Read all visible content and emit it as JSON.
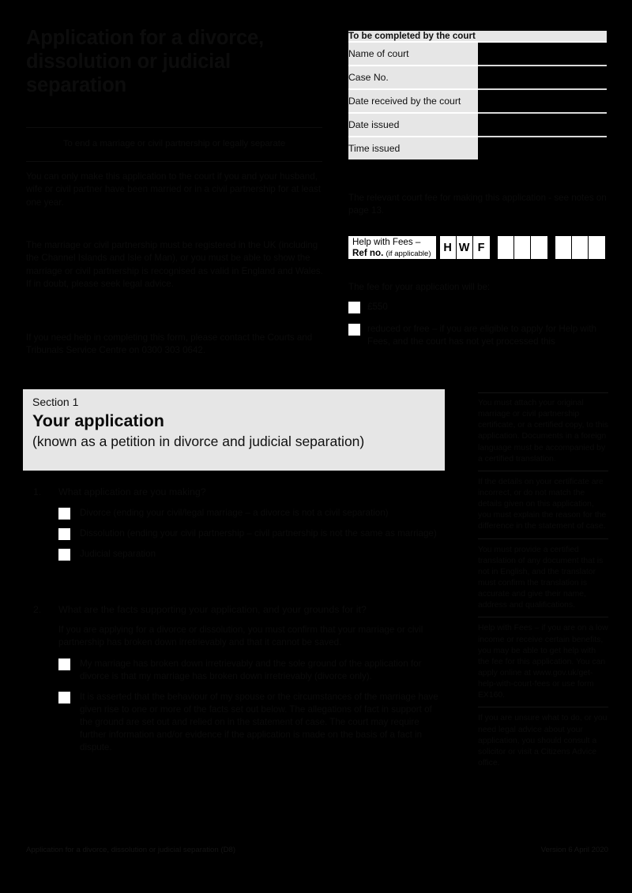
{
  "document": {
    "title": "Application for a divorce, dissolution or judicial separation",
    "lede": "To end a marriage or civil partnership or legally separate",
    "intro_paragraphs": [
      "You can only make this application to the court if you and your husband, wife or civil partner have been married or in a civil partnership for at least one year.",
      "The marriage or civil partnership must be registered in the UK (including the Channel Islands and Isle of Man), or you must be able to show the marriage or civil partnership is recognised as valid in England and Wales. If in doubt, please seek legal advice.",
      "If you need help in completing this form, please contact the Courts and Tribunals Service Centre on 0300 303 0642."
    ],
    "footer": {
      "left": "Application for a divorce, dissolution or judicial separation (D8)",
      "right": "Version 6  April 2020"
    }
  },
  "court_table": {
    "heading": "To be completed by the court",
    "rows": [
      {
        "label": "Name of court",
        "value": ""
      },
      {
        "label": "Case No.",
        "value": ""
      },
      {
        "label": "Date received by the court",
        "value": ""
      },
      {
        "label": "Date issued",
        "value": ""
      },
      {
        "label": "Time issued",
        "value": ""
      }
    ]
  },
  "fees": {
    "note": "The relevant court fee for making this application - see notes on page 13.",
    "help_with_fees": {
      "label_line1": "Help with Fees –",
      "label_line2_bold": "Ref no.",
      "label_line2_small": "(if applicable)",
      "prefix_letters": [
        "H",
        "W",
        "F"
      ],
      "group1": [
        "",
        "",
        ""
      ],
      "group2": [
        "",
        "",
        ""
      ]
    },
    "payment_intro": "The fee for your application will be:",
    "payment_options": [
      "£550",
      "reduced or free – if you are eligible to apply for Help with Fees, and the court has not yet processed this"
    ]
  },
  "section": {
    "number": "Section 1",
    "title": "Your application",
    "subtitle": "(known as a petition in divorce and judicial separation)"
  },
  "questions": [
    {
      "num": "1.",
      "text": "What application are you making?",
      "options": [
        "Divorce (ending your civil/legal marriage – a divorce is not a civil separation)",
        "Dissolution (ending your civil partnership – civil partnership is not the same as marriage)",
        "Judicial separation"
      ],
      "note": ""
    },
    {
      "num": "2.",
      "text": "What are the facts supporting your application, and your grounds for it?",
      "note": "If you are applying for a divorce or dissolution, you must confirm that your marriage or civil partnership has broken down irretrievably and that it cannot be saved.",
      "options": [
        "My marriage has broken down irretrievably and the sole ground of the application for divorce is that my marriage has broken down irretrievably (divorce only).",
        "It is asserted that the behaviour of my spouse or the circumstances of the marriage have given rise to one or more of the facts set out below. The allegations of fact in support of the ground are set out and relied on in the statement of case. The court may require further information and/or evidence if the application is made on the basis of a fact in dispute."
      ]
    }
  ],
  "notes_column": [
    "You must attach your original marriage or civil partnership certificate, or a certified copy, to this application. Documents in a foreign language must be accompanied by a certified translation.",
    "If the details on your certificate are incorrect, or do not match the details given on this application, you must explain the reason for the difference in the statement of case.",
    "You must provide a certified translation of any document that is not in English, and the translator must confirm the translation is accurate and give their name, address and qualifications.",
    "Help with Fees – if you are on a low income or receive certain benefits, you may be able to get help with the fee for this application. You can apply online at www.gov.uk/get-help-with-court-fees or use form EX160.",
    "If you are unsure what to do, or you need legal advice about your application, you should consult a solicitor or visit a Citizens Advice office."
  ]
}
